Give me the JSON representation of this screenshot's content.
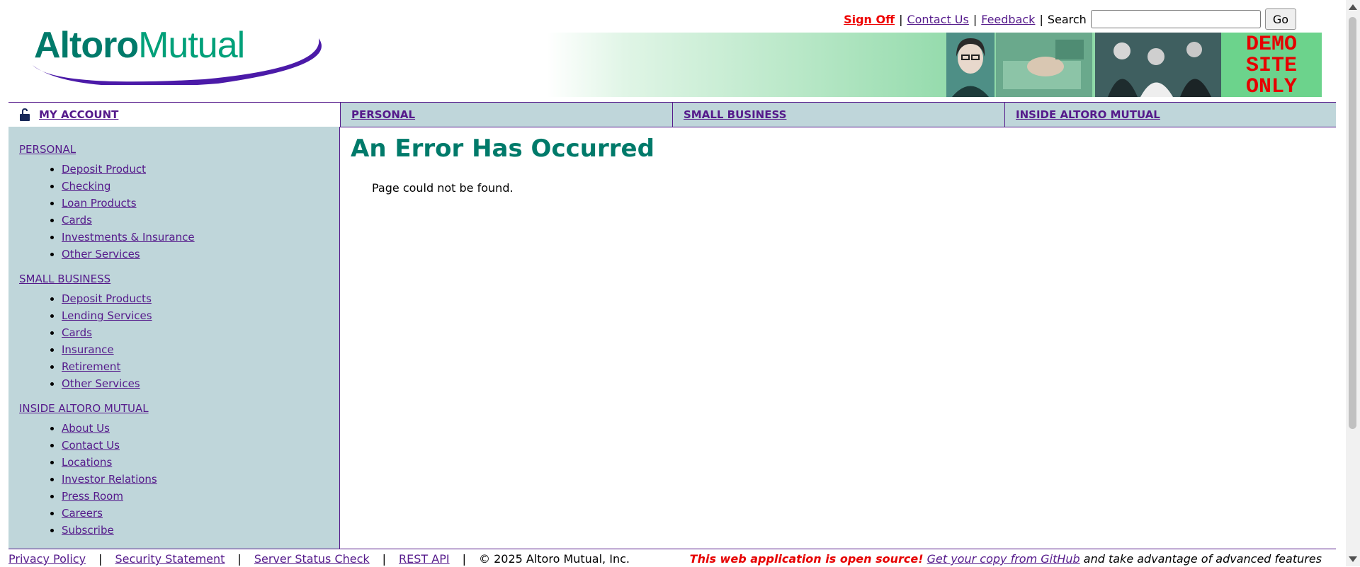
{
  "header": {
    "logo_part1": "Altoro",
    "logo_part2": "Mutual",
    "links": {
      "sign_off": "Sign Off",
      "contact_us": "Contact Us",
      "feedback": "Feedback",
      "separator": "|",
      "search_label": "Search",
      "search_value": "",
      "go": "Go"
    },
    "banner_stamp": [
      "DEMO",
      "SITE",
      "ONLY"
    ]
  },
  "nav": {
    "my_account": "MY ACCOUNT",
    "tabs": [
      "PERSONAL",
      "SMALL BUSINESS",
      "INSIDE ALTORO MUTUAL"
    ]
  },
  "sidebar": {
    "sections": [
      {
        "title": "PERSONAL",
        "items": [
          "Deposit Product",
          "Checking",
          "Loan Products",
          "Cards",
          "Investments & Insurance",
          "Other Services"
        ]
      },
      {
        "title": "SMALL BUSINESS",
        "items": [
          "Deposit Products",
          "Lending Services",
          "Cards",
          "Insurance",
          "Retirement",
          "Other Services"
        ]
      },
      {
        "title": "INSIDE ALTORO MUTUAL",
        "items": [
          "About Us",
          "Contact Us",
          "Locations",
          "Investor Relations",
          "Press Room",
          "Careers",
          "Subscribe"
        ]
      }
    ]
  },
  "main": {
    "title": "An Error Has Occurred",
    "message": "Page could not be found."
  },
  "footer": {
    "links": [
      "Privacy Policy",
      "Security Statement",
      "Server Status Check",
      "REST API"
    ],
    "separator": "|",
    "copyright": "© 2025 Altoro Mutual, Inc.",
    "open_source": "This web application is open source!",
    "github_link": "Get your copy from GitHub",
    "tail": "and take advantage of advanced features"
  },
  "colors": {
    "brand_green": "#007a6a",
    "link_purple": "#551a8b",
    "nav_bg": "#bfd6da",
    "alert_red": "#e60000"
  }
}
